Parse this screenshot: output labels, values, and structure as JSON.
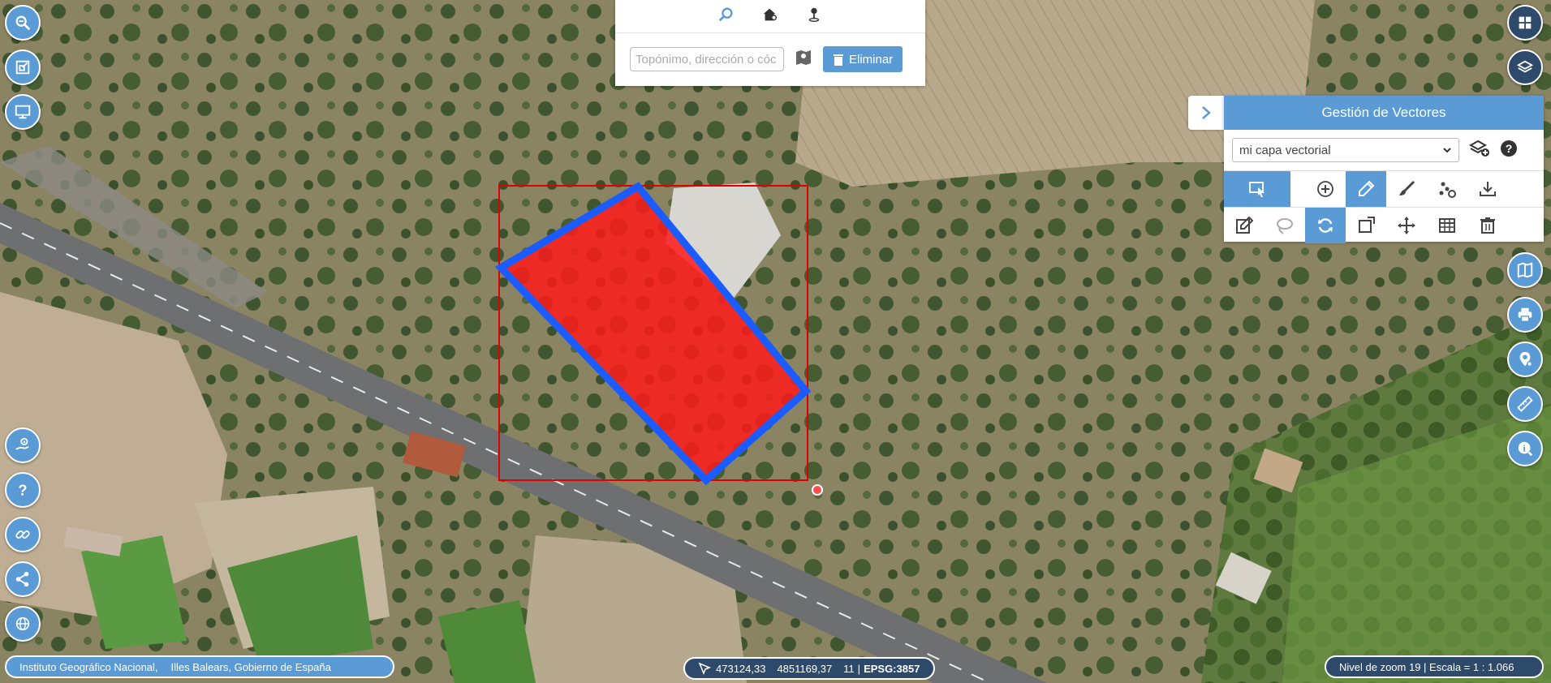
{
  "search": {
    "placeholder": "Topónimo, dirección o cóc",
    "clear_label": "Eliminar"
  },
  "panel": {
    "title": "Gestión de Vectores",
    "layer_selected": "mi capa vectorial"
  },
  "attribution": {
    "source1": "Instituto Geográfico Nacional,",
    "source2": "Illes Balears, Gobierno de España"
  },
  "coords": {
    "x": "473124,33",
    "y": "4851169,37",
    "zoom": "11",
    "epsg": "EPSG:3857"
  },
  "scale": {
    "text": "Nivel de zoom 19 | Escala = 1 : 1.066"
  },
  "colors": {
    "accent": "#5b9bd5",
    "dark": "#2e4a6a",
    "polygon_fill": "#ff1a1a",
    "polygon_stroke": "#1a5cff",
    "bbox_stroke": "#e00000"
  }
}
